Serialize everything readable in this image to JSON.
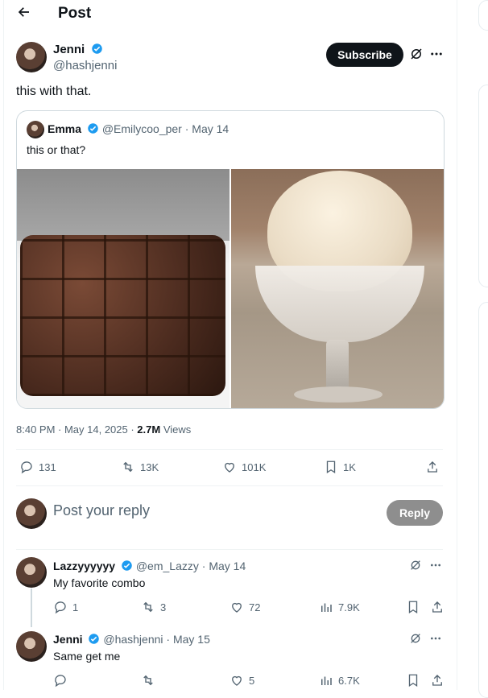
{
  "header": {
    "back_icon": "arrow-left-icon",
    "title": "Post"
  },
  "post": {
    "author_name": "Jenni",
    "author_handle": "@hashjenni",
    "subscribe_label": "Subscribe",
    "text": "this with that.",
    "timestamp": "8:40 PM · May 14, 2025 · ",
    "views_count": "2.7M",
    "views_label": " Views",
    "actions": {
      "replies": "131",
      "reposts": "13K",
      "likes": "101K",
      "bookmarks": "1K"
    }
  },
  "quote": {
    "author_name": "Emma",
    "author_handle": "@Emilycoo_per",
    "date": "· May 14",
    "text": "this or that?",
    "images": [
      "brownies",
      "ice cream in glass bowl"
    ]
  },
  "reply_box": {
    "placeholder": "Post your reply",
    "button_label": "Reply"
  },
  "replies": [
    {
      "author_name": "Lazzyyyyyy",
      "author_handle": "@em_Lazzy",
      "date": "· May 14",
      "text": "My favorite combo",
      "replies": "1",
      "reposts": "3",
      "likes": "72",
      "views": "7.9K"
    },
    {
      "author_name": "Jenni",
      "author_handle": "@hashjenni",
      "date": "· May 15",
      "text": "Same get me",
      "replies": "",
      "reposts": "",
      "likes": "5",
      "views": "6.7K"
    }
  ],
  "colors": {
    "verified": "#1d9bf0",
    "text": "#0f1419",
    "muted": "#536471",
    "border": "#cfd9de"
  }
}
